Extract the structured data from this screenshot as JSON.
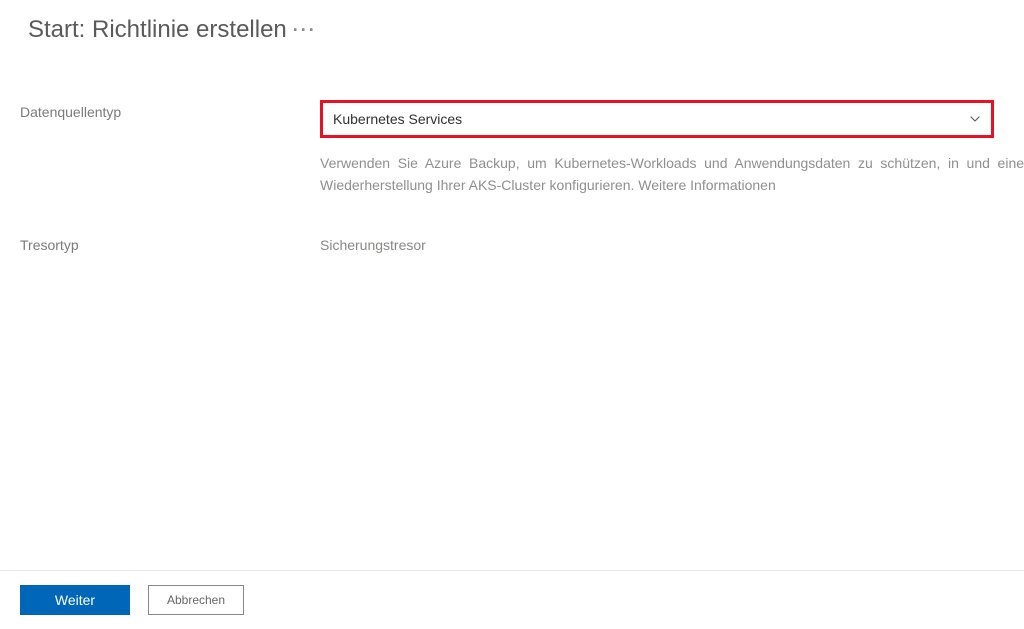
{
  "header": {
    "title": "Start: Richtlinie erstellen"
  },
  "form": {
    "datasource_label": "Datenquellentyp",
    "datasource_value": "Kubernetes Services",
    "help_text_part1": "Verwenden Sie Azure Backup, um Kubernetes-Workloads und Anwendungsdaten zu schützen, in",
    "help_text_part2": "und eine Wiederherstellung Ihrer AKS-Cluster konfigurieren. ",
    "help_link_text": "Weitere Informationen",
    "vaulttype_label": "Tresortyp",
    "vaulttype_value": "Sicherungstresor"
  },
  "footer": {
    "next_label": "Weiter",
    "cancel_label": "Abbrechen"
  }
}
